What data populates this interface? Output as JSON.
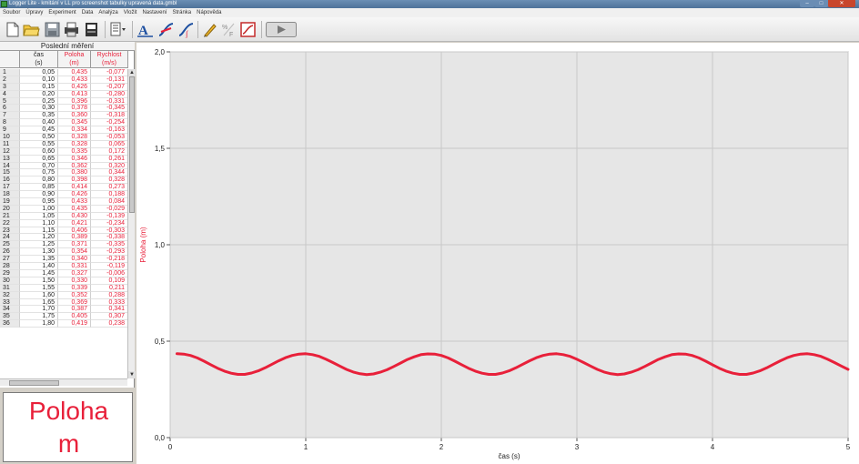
{
  "window": {
    "title": "Logger Lite - kmitání v LL pro screenshot tabulky upravená data.gmbl"
  },
  "menu": [
    "Soubor",
    "Úpravy",
    "Experiment",
    "Data",
    "Analýza",
    "Vložit",
    "Nastavení",
    "Stránka",
    "Nápověda"
  ],
  "toolbar": {
    "icons": [
      "new-file-icon",
      "open-folder-icon",
      "save-icon",
      "print-icon",
      "print-graph-icon",
      "page-setup-icon",
      "text-annotation-icon",
      "tangent-icon",
      "integral-icon",
      "draw-prediction-icon",
      "model-fx-icon",
      "autoscale-icon",
      "collect-button"
    ]
  },
  "table": {
    "title": "Poslední měření",
    "columns": [
      {
        "name": "čas",
        "unit": "(s)"
      },
      {
        "name": "Poloha",
        "unit": "(m)"
      },
      {
        "name": "Rychlost",
        "unit": "(m/s)"
      }
    ],
    "rows": [
      [
        "1",
        "0,05",
        "0,435",
        "-0,077"
      ],
      [
        "2",
        "0,10",
        "0,433",
        "-0,131"
      ],
      [
        "3",
        "0,15",
        "0,426",
        "-0,207"
      ],
      [
        "4",
        "0,20",
        "0,413",
        "-0,280"
      ],
      [
        "5",
        "0,25",
        "0,396",
        "-0,331"
      ],
      [
        "6",
        "0,30",
        "0,378",
        "-0,345"
      ],
      [
        "7",
        "0,35",
        "0,360",
        "-0,318"
      ],
      [
        "8",
        "0,40",
        "0,345",
        "-0,254"
      ],
      [
        "9",
        "0,45",
        "0,334",
        "-0,163"
      ],
      [
        "10",
        "0,50",
        "0,328",
        "-0,053"
      ],
      [
        "11",
        "0,55",
        "0,328",
        "0,065"
      ],
      [
        "12",
        "0,60",
        "0,335",
        "0,172"
      ],
      [
        "13",
        "0,65",
        "0,346",
        "0,261"
      ],
      [
        "14",
        "0,70",
        "0,362",
        "0,320"
      ],
      [
        "15",
        "0,75",
        "0,380",
        "0,344"
      ],
      [
        "16",
        "0,80",
        "0,398",
        "0,328"
      ],
      [
        "17",
        "0,85",
        "0,414",
        "0,273"
      ],
      [
        "18",
        "0,90",
        "0,426",
        "0,188"
      ],
      [
        "19",
        "0,95",
        "0,433",
        "0,084"
      ],
      [
        "20",
        "1,00",
        "0,435",
        "-0,029"
      ],
      [
        "21",
        "1,05",
        "0,430",
        "-0,139"
      ],
      [
        "22",
        "1,10",
        "0,421",
        "-0,234"
      ],
      [
        "23",
        "1,15",
        "0,406",
        "-0,303"
      ],
      [
        "24",
        "1,20",
        "0,389",
        "-0,338"
      ],
      [
        "25",
        "1,25",
        "0,371",
        "-0,335"
      ],
      [
        "26",
        "1,30",
        "0,354",
        "-0,293"
      ],
      [
        "27",
        "1,35",
        "0,340",
        "-0,218"
      ],
      [
        "28",
        "1,40",
        "0,331",
        "-0,119"
      ],
      [
        "29",
        "1,45",
        "0,327",
        "-0,006"
      ],
      [
        "30",
        "1,50",
        "0,330",
        "0,109"
      ],
      [
        "31",
        "1,55",
        "0,339",
        "0,211"
      ],
      [
        "32",
        "1,60",
        "0,352",
        "0,288"
      ],
      [
        "33",
        "1,65",
        "0,369",
        "0,333"
      ],
      [
        "34",
        "1,70",
        "0,387",
        "0,341"
      ],
      [
        "35",
        "1,75",
        "0,405",
        "0,307"
      ],
      [
        "36",
        "1,80",
        "0,419",
        "0,238"
      ]
    ]
  },
  "meter": {
    "label": "Poloha",
    "unit": "m"
  },
  "colors": {
    "series": "#e8203a",
    "plot_bg": "#e6e6e6",
    "grid": "#c8c8c8"
  },
  "chart_data": {
    "type": "line",
    "xlabel": "čas (s)",
    "ylabel": "Poloha (m)",
    "xlim": [
      0,
      5
    ],
    "ylim": [
      0,
      2
    ],
    "x_ticks": [
      "0",
      "1",
      "2",
      "3",
      "4",
      "5"
    ],
    "y_ticks": [
      "0,0",
      "0,5",
      "1,0",
      "1,5",
      "2,0"
    ],
    "grid": true,
    "series": [
      {
        "name": "Poloha",
        "x": [
          0.05,
          0.1,
          0.15,
          0.2,
          0.25,
          0.3,
          0.35,
          0.4,
          0.45,
          0.5,
          0.55,
          0.6,
          0.65,
          0.7,
          0.75,
          0.8,
          0.85,
          0.9,
          0.95,
          1.0,
          1.05,
          1.1,
          1.15,
          1.2,
          1.25,
          1.3,
          1.35,
          1.4,
          1.45,
          1.5,
          1.55,
          1.6,
          1.65,
          1.7,
          1.75,
          1.8,
          1.85,
          1.9,
          1.95,
          2.0,
          2.05,
          2.1,
          2.15,
          2.2,
          2.25,
          2.3,
          2.35,
          2.4,
          2.45,
          2.5,
          2.55,
          2.6,
          2.65,
          2.7,
          2.75,
          2.8,
          2.85,
          2.9,
          2.95,
          3.0,
          3.05,
          3.1,
          3.15,
          3.2,
          3.25,
          3.3,
          3.35,
          3.4,
          3.45,
          3.5,
          3.55,
          3.6,
          3.65,
          3.7,
          3.75,
          3.8,
          3.85,
          3.9,
          3.95,
          4.0,
          4.05,
          4.1,
          4.15,
          4.2,
          4.25,
          4.3,
          4.35,
          4.4,
          4.45,
          4.5,
          4.55,
          4.6,
          4.65,
          4.7,
          4.75,
          4.8,
          4.85,
          4.9,
          4.95,
          5.0
        ],
        "y": [
          0.435,
          0.433,
          0.426,
          0.413,
          0.396,
          0.378,
          0.36,
          0.345,
          0.334,
          0.328,
          0.328,
          0.335,
          0.346,
          0.362,
          0.38,
          0.398,
          0.414,
          0.426,
          0.433,
          0.435,
          0.43,
          0.421,
          0.406,
          0.389,
          0.371,
          0.354,
          0.34,
          0.331,
          0.327,
          0.33,
          0.339,
          0.352,
          0.369,
          0.387,
          0.405,
          0.419,
          0.43,
          0.434,
          0.433,
          0.426,
          0.413,
          0.396,
          0.378,
          0.36,
          0.345,
          0.334,
          0.328,
          0.328,
          0.335,
          0.346,
          0.362,
          0.38,
          0.398,
          0.414,
          0.426,
          0.433,
          0.435,
          0.43,
          0.421,
          0.406,
          0.389,
          0.371,
          0.354,
          0.34,
          0.331,
          0.327,
          0.33,
          0.339,
          0.352,
          0.369,
          0.387,
          0.405,
          0.419,
          0.43,
          0.434,
          0.433,
          0.426,
          0.413,
          0.396,
          0.378,
          0.36,
          0.345,
          0.334,
          0.328,
          0.328,
          0.335,
          0.346,
          0.362,
          0.38,
          0.398,
          0.414,
          0.426,
          0.433,
          0.435,
          0.43,
          0.421,
          0.406,
          0.389,
          0.371,
          0.354
        ]
      }
    ]
  }
}
